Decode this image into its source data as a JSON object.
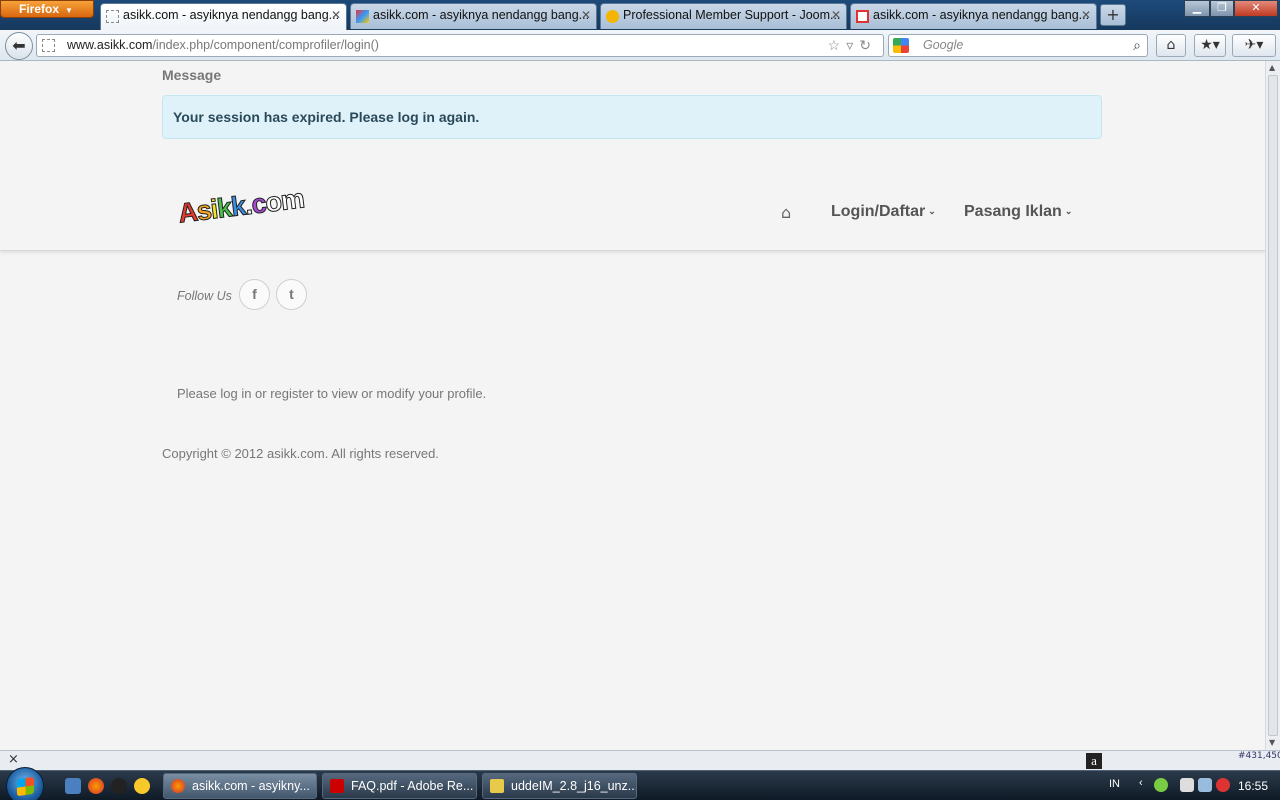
{
  "browser": {
    "menu_button": "Firefox",
    "tabs": [
      {
        "title": "asikk.com - asyiknya nendangg bang...",
        "active": true
      },
      {
        "title": "asikk.com - asyiknya nendangg bang...",
        "active": false
      },
      {
        "title": "Professional Member Support - Joom...",
        "active": false
      },
      {
        "title": "asikk.com - asyiknya nendangg bang...",
        "active": false
      }
    ],
    "url_host": "www.asikk.com",
    "url_path": "/index.php/component/comprofiler/login()",
    "search_placeholder": "Google"
  },
  "page": {
    "message_heading": "Message",
    "alert_text": "Your session has expired. Please log in again.",
    "logo_text": "Asikk.com",
    "nav": {
      "login": "Login/Daftar",
      "pasang": "Pasang Iklan"
    },
    "follow_label": "Follow Us",
    "facebook_glyph": "f",
    "twitter_glyph": "t",
    "body_text": "Please log in or register to view or modify your profile.",
    "copyright": "Copyright © 2012 asikk.com. All rights reserved."
  },
  "statusbar": {
    "close_glyph": "×",
    "alexa_glyph": "a",
    "alexa_rank": "#431,450"
  },
  "taskbar": {
    "tasks": [
      {
        "label": "asikk.com - asyikny..."
      },
      {
        "label": "FAQ.pdf - Adobe Re..."
      },
      {
        "label": "uddeIM_2.8_j16_unz..."
      }
    ],
    "lang": "IN",
    "clock": "16:55"
  },
  "colors": {
    "alert_bg": "#e0f2f9",
    "page_bg": "#f4f4f4",
    "firefox_orange": "#e07a1c"
  }
}
